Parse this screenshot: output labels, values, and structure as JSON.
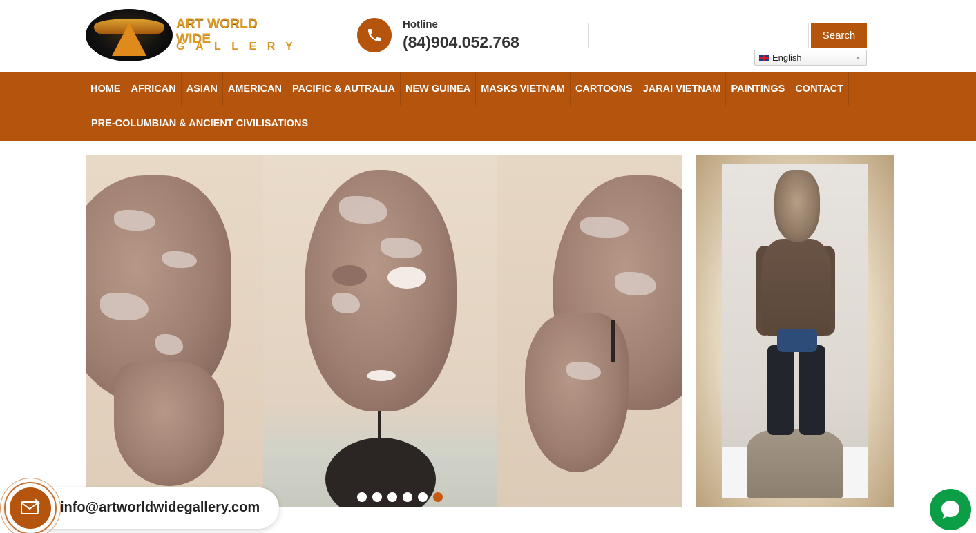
{
  "header": {
    "logo": {
      "title": "ART WORLD WIDE",
      "subtitle": "GALLERY",
      "icon": "pyramid-logo-icon"
    },
    "hotline": {
      "label": "Hotline",
      "number": "(84)904.052.768",
      "icon": "phone-icon"
    },
    "search": {
      "value": "",
      "placeholder": "",
      "button_label": "Search"
    },
    "language": {
      "selected": "English",
      "icon": "uk-flag-icon"
    }
  },
  "nav": {
    "row1": [
      {
        "label": "HOME"
      },
      {
        "label": "AFRICAN"
      },
      {
        "label": "ASIAN"
      },
      {
        "label": "AMERICAN"
      },
      {
        "label": "PACIFIC & AUTRALIA"
      },
      {
        "label": "NEW GUINEA"
      },
      {
        "label": "MASKS VIETNAM"
      },
      {
        "label": "CARTOONS"
      },
      {
        "label": "JARAI VIETNAM"
      },
      {
        "label": "PAINTINGS"
      },
      {
        "label": "CONTACT"
      }
    ],
    "row2": [
      {
        "label": "PRE-COLUMBIAN & ANCIENT CIVILISATIONS"
      }
    ]
  },
  "slider": {
    "slide_count": 6,
    "active_index": 5
  },
  "floating_contact": {
    "email": "info@artworldwidegallery.com",
    "icon": "email-icon"
  },
  "chat": {
    "icon": "chat-icon"
  },
  "colors": {
    "brand": "#b5540c",
    "chat": "#0b9e46",
    "logo_gold": "#e09a22"
  }
}
